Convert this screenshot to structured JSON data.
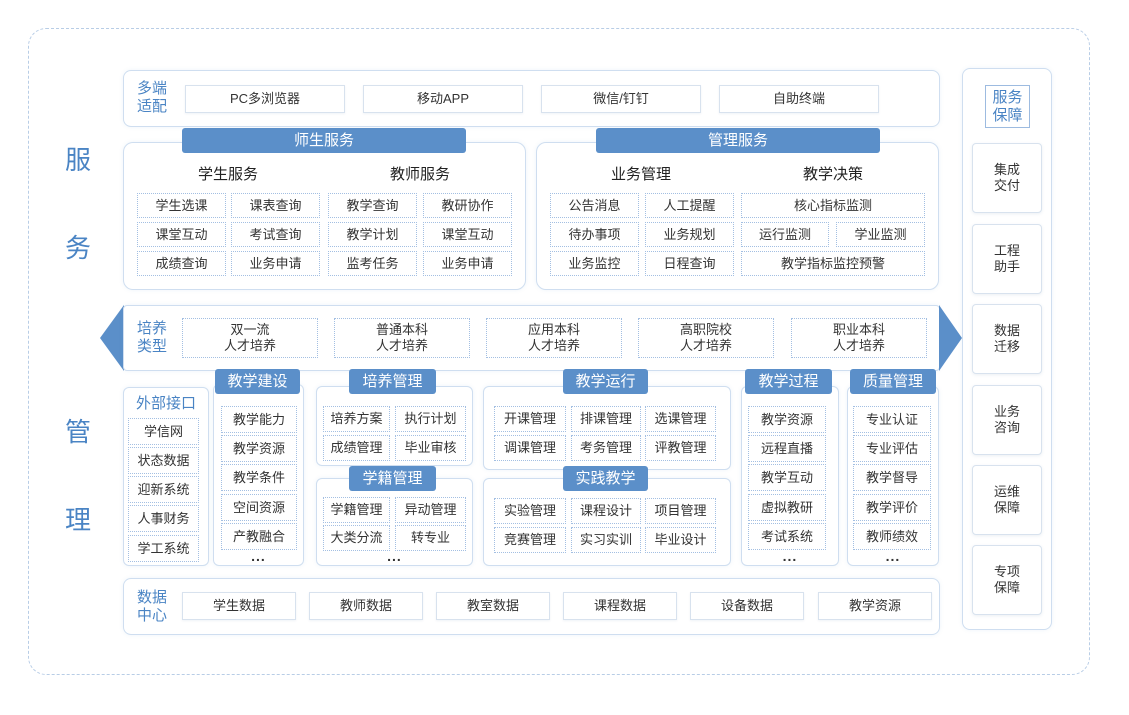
{
  "side_labels": {
    "service": [
      "服",
      "务"
    ],
    "management": [
      "管",
      "理"
    ]
  },
  "terminals": {
    "label": [
      "多端",
      "适配"
    ],
    "items": [
      "PC多浏览器",
      "移动APP",
      "微信/钉钉",
      "自助终端"
    ]
  },
  "teacher_student_services": {
    "title": "师生服务",
    "student": {
      "title": "学生服务",
      "items": [
        "学生选课",
        "课表查询",
        "课堂互动",
        "考试查询",
        "成绩查询",
        "业务申请"
      ]
    },
    "teacher": {
      "title": "教师服务",
      "items": [
        "教学查询",
        "教研协作",
        "教学计划",
        "课堂互动",
        "监考任务",
        "业务申请"
      ]
    }
  },
  "management_services": {
    "title": "管理服务",
    "business": {
      "title": "业务管理",
      "items": [
        "公告消息",
        "人工提醒",
        "待办事项",
        "业务规划",
        "业务监控",
        "日程查询"
      ]
    },
    "decision": {
      "title": "教学决策",
      "items": [
        "核心指标监测",
        "运行监测",
        "学业监测",
        "教学指标监控预警"
      ]
    }
  },
  "training_types": {
    "label": [
      "培养",
      "类型"
    ],
    "items": [
      [
        "双一流",
        "人才培养"
      ],
      [
        "普通本科",
        "人才培养"
      ],
      [
        "应用本科",
        "人才培养"
      ],
      [
        "高职院校",
        "人才培养"
      ],
      [
        "职业本科",
        "人才培养"
      ]
    ]
  },
  "external_interfaces": {
    "title": "外部接口",
    "items": [
      "学信网",
      "状态数据",
      "迎新系统",
      "人事财务",
      "学工系统"
    ]
  },
  "teaching_construction": {
    "title": "教学建设",
    "items": [
      "教学能力",
      "教学资源",
      "教学条件",
      "空间资源",
      "产教融合"
    ],
    "more": "..."
  },
  "training_management": {
    "title": "培养管理",
    "items": [
      "培养方案",
      "执行计划",
      "成绩管理",
      "毕业审核"
    ]
  },
  "student_status": {
    "title": "学籍管理",
    "items": [
      "学籍管理",
      "异动管理",
      "大类分流",
      "转专业"
    ],
    "more": "..."
  },
  "teaching_operation": {
    "title": "教学运行",
    "items": [
      "开课管理",
      "排课管理",
      "选课管理",
      "调课管理",
      "考务管理",
      "评教管理"
    ]
  },
  "practice_teaching": {
    "title": "实践教学",
    "items": [
      "实验管理",
      "课程设计",
      "项目管理",
      "竞赛管理",
      "实习实训",
      "毕业设计"
    ]
  },
  "teaching_process": {
    "title": "教学过程",
    "items": [
      "教学资源",
      "远程直播",
      "教学互动",
      "虚拟教研",
      "考试系统"
    ],
    "more": "..."
  },
  "quality_management": {
    "title": "质量管理",
    "items": [
      "专业认证",
      "专业评估",
      "教学督导",
      "教学评价",
      "教师绩效"
    ],
    "more": "..."
  },
  "data_center": {
    "label": [
      "数据",
      "中心"
    ],
    "items": [
      "学生数据",
      "教师数据",
      "教室数据",
      "课程数据",
      "设备数据",
      "教学资源"
    ]
  },
  "service_guarantee": {
    "title": [
      "服务",
      "保障"
    ],
    "items": [
      [
        "集成",
        "交付"
      ],
      [
        "工程",
        "助手"
      ],
      [
        "数据",
        "迁移"
      ],
      [
        "业务",
        "咨询"
      ],
      [
        "运维",
        "保障"
      ],
      [
        "专项",
        "保障"
      ]
    ]
  },
  "colors": {
    "accent": "#5b8fc9",
    "label_text": "#4a84c4",
    "panel_border": "#cfdef0",
    "item_border": "#a3bfe2"
  }
}
